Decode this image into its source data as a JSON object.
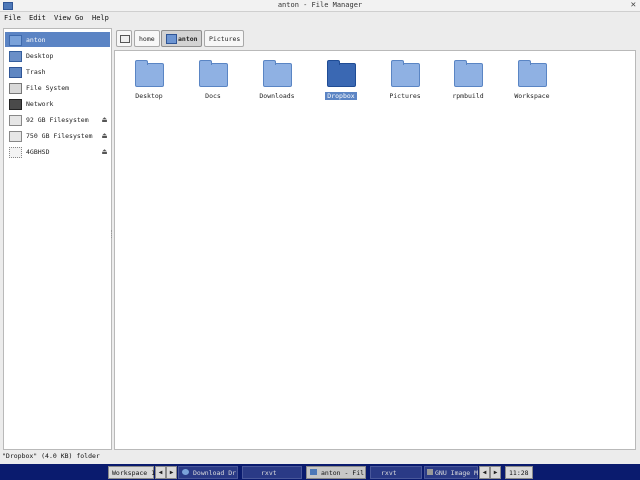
{
  "window": {
    "title": "anton - File Manager",
    "close_glyph": "✕"
  },
  "menu": {
    "items": [
      "File",
      "Edit",
      "View",
      "Go",
      "Help"
    ]
  },
  "sidebar": {
    "items": [
      {
        "label": "anton",
        "icon": "home-folder-icon",
        "selected": true
      },
      {
        "label": "Desktop",
        "icon": "desktop-icon"
      },
      {
        "label": "Trash",
        "icon": "trash-icon"
      },
      {
        "label": "File System",
        "icon": "filesystem-icon"
      },
      {
        "label": "Network",
        "icon": "network-icon"
      },
      {
        "label": "92 GB Filesystem",
        "icon": "drive-icon",
        "eject": true
      },
      {
        "label": "750 GB Filesystem",
        "icon": "drive-icon",
        "eject": true
      },
      {
        "label": "4GBHSD",
        "icon": "usb-drive-icon",
        "eject": true
      }
    ]
  },
  "pathbar": {
    "items": [
      "home",
      "anton",
      "Pictures"
    ]
  },
  "files": [
    "Desktop",
    "Docs",
    "Downloads",
    "Dropbox",
    "Pictures",
    "rpmbuild",
    "Workspace"
  ],
  "selected_file": "Dropbox",
  "status": {
    "text": "\"Dropbox\" (4.0 KB) folder"
  },
  "taskbar": {
    "workspace": "Workspace 1",
    "tasks": [
      "Download Dr",
      "rxvt",
      "anton - Fil",
      "rxvt",
      "GNU Image M"
    ],
    "clock": "11:28"
  },
  "colors": {
    "selection": "#5b84c4",
    "folder": "#8fb1e3",
    "taskbar": "#0a1b6e"
  }
}
